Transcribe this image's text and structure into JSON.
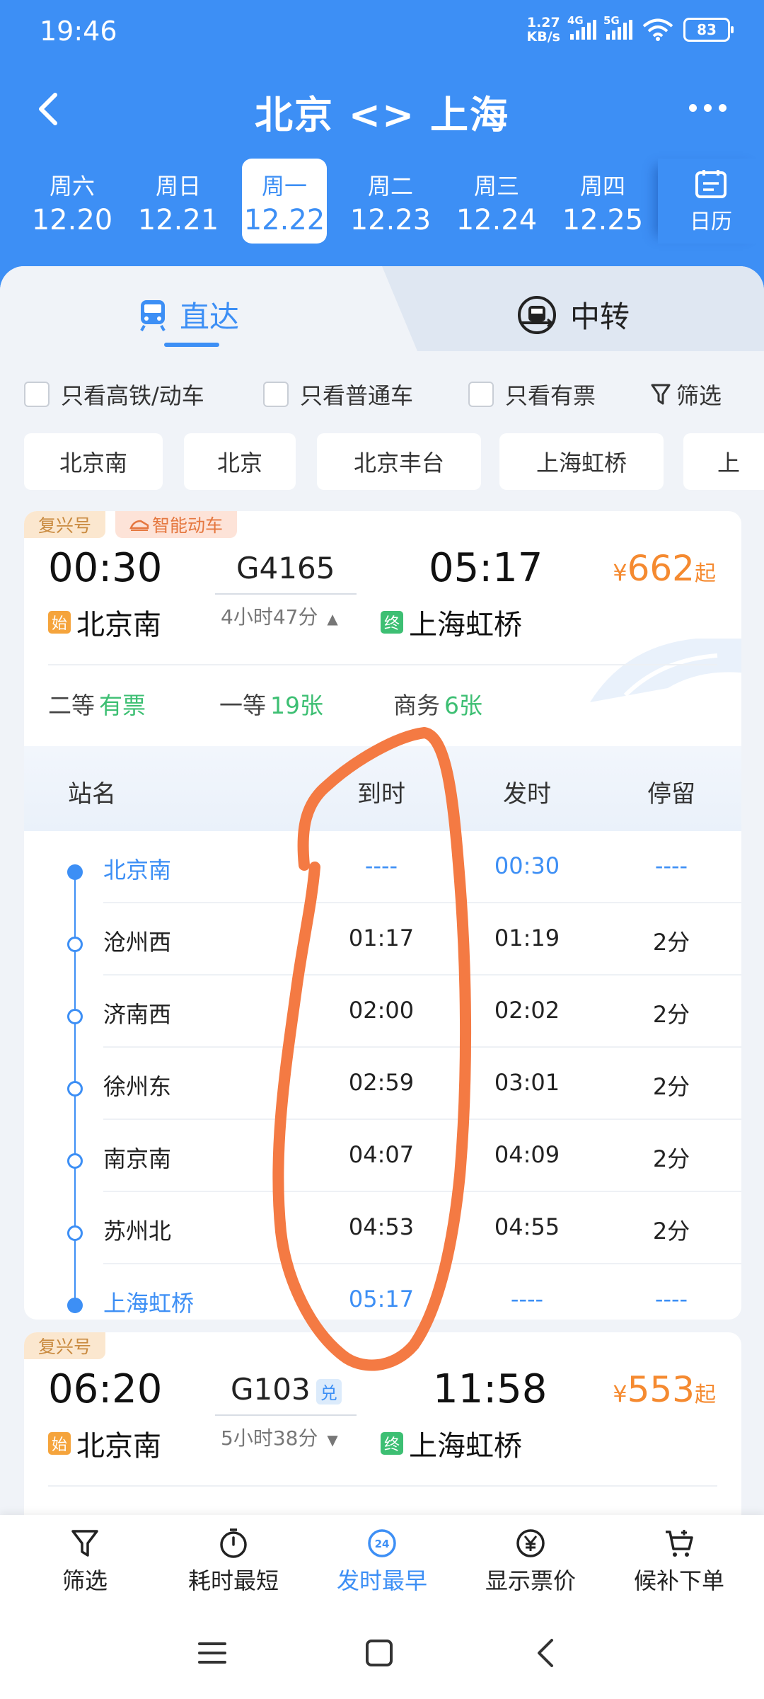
{
  "status": {
    "time": "19:46",
    "net_speed_top": "1.27",
    "net_speed_bottom": "KB/s",
    "sig1": "4G",
    "sig2": "5G",
    "battery": "83"
  },
  "title": "北京 <> 上海",
  "dates": [
    {
      "weekday": "周六",
      "date": "12.20"
    },
    {
      "weekday": "周日",
      "date": "12.21"
    },
    {
      "weekday": "周一",
      "date": "12.22",
      "active": true
    },
    {
      "weekday": "周二",
      "date": "12.23"
    },
    {
      "weekday": "周三",
      "date": "12.24"
    },
    {
      "weekday": "周四",
      "date": "12.25"
    }
  ],
  "calendar_label": "日历",
  "tabs": {
    "direct": "直达",
    "transfer": "中转"
  },
  "filters": {
    "high_speed": "只看高铁/动车",
    "normal": "只看普通车",
    "available": "只看有票",
    "filter": "筛选"
  },
  "stations": [
    "北京南",
    "北京",
    "北京丰台",
    "上海虹桥",
    "上"
  ],
  "train1": {
    "badge1": "复兴号",
    "badge2": "智能动车",
    "dep_time": "00:30",
    "number": "G4165",
    "arr_time": "05:17",
    "duration": "4小时47分",
    "dep_station": "北京南",
    "arr_station": "上海虹桥",
    "start_tag": "始",
    "end_tag": "终",
    "price_currency": "¥",
    "price": "662",
    "price_suffix": "起",
    "seats": [
      {
        "class": "二等",
        "avail": "有票"
      },
      {
        "class": "一等",
        "avail": "19张"
      },
      {
        "class": "商务",
        "avail": "6张"
      }
    ],
    "table_header": {
      "station": "站名",
      "arrive": "到时",
      "depart": "发时",
      "stay": "停留"
    },
    "stops": [
      {
        "name": "北京南",
        "arrive": "----",
        "depart": "00:30",
        "stay": "----",
        "highlight": true
      },
      {
        "name": "沧州西",
        "arrive": "01:17",
        "depart": "01:19",
        "stay": "2分"
      },
      {
        "name": "济南西",
        "arrive": "02:00",
        "depart": "02:02",
        "stay": "2分"
      },
      {
        "name": "徐州东",
        "arrive": "02:59",
        "depart": "03:01",
        "stay": "2分"
      },
      {
        "name": "南京南",
        "arrive": "04:07",
        "depart": "04:09",
        "stay": "2分"
      },
      {
        "name": "苏州北",
        "arrive": "04:53",
        "depart": "04:55",
        "stay": "2分"
      },
      {
        "name": "上海虹桥",
        "arrive": "05:17",
        "depart": "----",
        "stay": "----",
        "highlight": true
      }
    ]
  },
  "train2": {
    "badge1": "复兴号",
    "dep_time": "06:20",
    "number": "G103",
    "dui": "兑",
    "arr_time": "11:58",
    "duration": "5小时38分",
    "dep_station": "北京南",
    "arr_station": "上海虹桥",
    "start_tag": "始",
    "end_tag": "终",
    "price_currency": "¥",
    "price": "553",
    "price_suffix": "起"
  },
  "bottom_bar": {
    "filter": "筛选",
    "shortest": "耗时最短",
    "earliest": "发时最早",
    "earliest_icon_num": "24",
    "show_price": "显示票价",
    "waitlist": "候补下单"
  },
  "colors": {
    "primary": "#3d8ff5",
    "price": "#f58a30",
    "available": "#3dbf73",
    "annotation": "#f47a43"
  }
}
